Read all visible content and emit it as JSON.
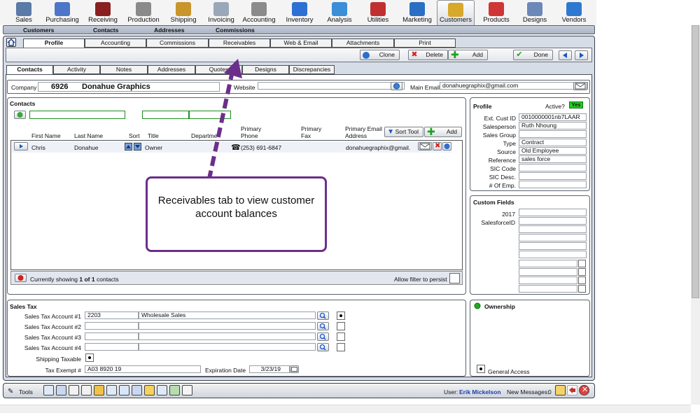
{
  "modules": [
    {
      "label": "Sales",
      "icon": "briefcase-icon",
      "color": "#5a7aa8"
    },
    {
      "label": "Purchasing",
      "icon": "cart-people-icon",
      "color": "#4d76c9"
    },
    {
      "label": "Receiving",
      "icon": "boxes-icon",
      "color": "#8a1f1f"
    },
    {
      "label": "Production",
      "icon": "gears-icon",
      "color": "#8a8a8a"
    },
    {
      "label": "Shipping",
      "icon": "package-icon",
      "color": "#c9962b"
    },
    {
      "label": "Invoicing",
      "icon": "invoice-icon",
      "color": "#9aa7b8"
    },
    {
      "label": "Accounting",
      "icon": "ledger-icon",
      "color": "#8b8b8b"
    },
    {
      "label": "Inventory",
      "icon": "shopping-cart-icon",
      "color": "#2e6fd3"
    },
    {
      "label": "Analysis",
      "icon": "chart-icon",
      "color": "#3a8fd8"
    },
    {
      "label": "Utilities",
      "icon": "tools-icon",
      "color": "#c03030"
    },
    {
      "label": "Marketing",
      "icon": "globe-icon",
      "color": "#2a6fc4"
    },
    {
      "label": "Customers",
      "icon": "customers-icon",
      "color": "#d8a82a"
    },
    {
      "label": "Products",
      "icon": "shapes-icon",
      "color": "#d03434"
    },
    {
      "label": "Designs",
      "icon": "pen-paper-icon",
      "color": "#6c88b8"
    },
    {
      "label": "Vendors",
      "icon": "vendors-icon",
      "color": "#2f78d0"
    }
  ],
  "submenu": [
    "Customers",
    "Contacts",
    "Addresses",
    "Commissions"
  ],
  "primary_tabs": [
    "Profile",
    "Accounting",
    "Commissions",
    "Receivables",
    "Web & Email",
    "Attachments",
    "Print"
  ],
  "actions": {
    "clone": "Clone",
    "delete": "Delete",
    "add": "Add",
    "done": "Done"
  },
  "secondary_tabs": [
    "Contacts",
    "Activity",
    "Notes",
    "Addresses",
    "Quotes",
    "Designs",
    "Discrepancies"
  ],
  "company": {
    "label": "Company",
    "id": "6926",
    "name": "Donahue Graphics",
    "website_label": "Website",
    "website": "",
    "email_label": "Main Email",
    "email": "donahuegraphix@gmail.com"
  },
  "contacts": {
    "title": "Contacts",
    "columns": {
      "first": "First Name",
      "last": "Last Name",
      "sort": "Sort",
      "title": "Title",
      "dept": "Departme",
      "phone": "Primary Phone",
      "fax": "Primary Fax",
      "email": "Primary Email Address"
    },
    "sort_tool": "Sort Tool",
    "add": "Add",
    "rows": [
      {
        "first": "Chris",
        "last": "Donahue",
        "title": "Owner",
        "phone": "(253) 691-6847",
        "email": "donahuegraphix@gmail."
      }
    ],
    "footer_pre": "Currently showing",
    "footer_count": "1 of 1",
    "footer_post": "contacts",
    "allow_filter": "Allow filter to persist"
  },
  "profile": {
    "title": "Profile",
    "active_label": "Active?",
    "active_value": "Yes",
    "fields": [
      {
        "label": "Ext. Cust ID",
        "value": "0010000001nb7LAAR"
      },
      {
        "label": "Salesperson",
        "value": "Ruth  Nhoung"
      },
      {
        "label": "Sales Group",
        "value": ""
      },
      {
        "label": "Type",
        "value": "Contract"
      },
      {
        "label": "Source",
        "value": "Old Employee"
      },
      {
        "label": "Reference",
        "value": "sales force"
      },
      {
        "label": "SIC Code",
        "value": ""
      },
      {
        "label": "SIC Desc.",
        "value": ""
      },
      {
        "label": "# Of Emp.",
        "value": ""
      }
    ]
  },
  "custom_fields": {
    "title": "Custom Fields",
    "labels": [
      "2017",
      "SalesforceID"
    ]
  },
  "sales_tax": {
    "title": "Sales Tax",
    "accounts": [
      {
        "label": "Sales Tax Account #1",
        "code": "2203",
        "desc": "Wholesale Sales"
      },
      {
        "label": "Sales Tax Account #2",
        "code": "",
        "desc": ""
      },
      {
        "label": "Sales Tax Account #3",
        "code": "",
        "desc": ""
      },
      {
        "label": "Sales Tax Account #4",
        "code": "",
        "desc": ""
      }
    ],
    "shipping_taxable": "Shipping Taxable",
    "tax_exempt_label": "Tax Exempt #",
    "tax_exempt": "A03 8920 19",
    "expiration_label": "Expiration Date",
    "expiration": "3/23/19"
  },
  "ownership": {
    "title": "Ownership",
    "general_access": "General Access"
  },
  "bottom": {
    "tools": "Tools",
    "user_label": "User:",
    "user": "Erik Mickelson",
    "messages_label": "New Messages:",
    "messages": "0"
  },
  "callout": {
    "text": "Receivables tab to view customer account balances"
  },
  "colors": {
    "accent_purple": "#6b2f8a",
    "active_green": "#22cc22",
    "frame_bg": "#d7dde6"
  }
}
